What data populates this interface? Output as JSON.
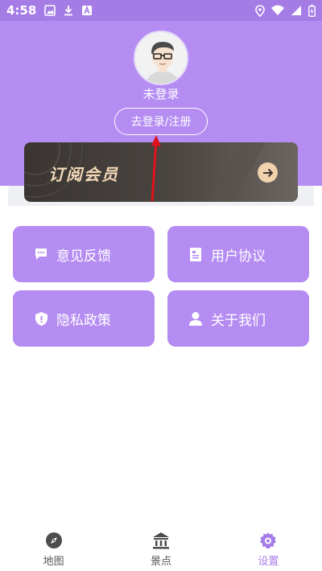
{
  "status_bar": {
    "time": "4:58"
  },
  "profile": {
    "username": "未登录",
    "login_label": "去登录/注册"
  },
  "vip": {
    "title": "订阅会员"
  },
  "menu": [
    {
      "label": "意见反馈",
      "icon": "chat-icon"
    },
    {
      "label": "用户协议",
      "icon": "document-icon"
    },
    {
      "label": "隐私政策",
      "icon": "shield-icon"
    },
    {
      "label": "关于我们",
      "icon": "person-icon"
    }
  ],
  "tabs": [
    {
      "label": "地图",
      "icon": "compass-icon",
      "active": false
    },
    {
      "label": "景点",
      "icon": "landmark-icon",
      "active": false
    },
    {
      "label": "设置",
      "icon": "gear-icon",
      "active": true
    }
  ],
  "colors": {
    "primary": "#b48cf2",
    "status_bar": "#a57be6",
    "vip_gold": "#f3d9b8",
    "annotation_arrow": "#e0121b"
  }
}
